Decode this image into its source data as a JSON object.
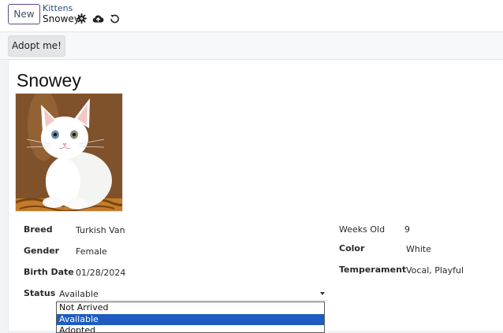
{
  "header": {
    "new_label": "New",
    "breadcrumb_parent": "Kittens",
    "breadcrumb_current": "Snowey"
  },
  "actions": {
    "adopt_label": "Adopt me!"
  },
  "record": {
    "title": "Snowey",
    "left_fields": [
      {
        "label": "Breed",
        "value": "Turkish Van"
      },
      {
        "label": "Gender",
        "value": "Female"
      },
      {
        "label": "Birth Date",
        "value": "01/28/2024"
      }
    ],
    "right_fields": [
      {
        "label": "Weeks Old",
        "value": "9"
      },
      {
        "label": "Color",
        "value": "White"
      },
      {
        "label": "Temperament",
        "value": "Vocal, Playful"
      }
    ],
    "status": {
      "label": "Status",
      "value": "Available",
      "options": [
        "Not Arrived",
        "Available",
        "Adopted"
      ],
      "highlighted_option": "Available"
    }
  },
  "colors": {
    "accent": "#5f4b8b",
    "link": "#2d4d80",
    "selection": "#1f5cbf"
  },
  "icons": [
    "gear-icon",
    "cloud-upload-icon",
    "undo-icon",
    "chevron-down-icon"
  ]
}
